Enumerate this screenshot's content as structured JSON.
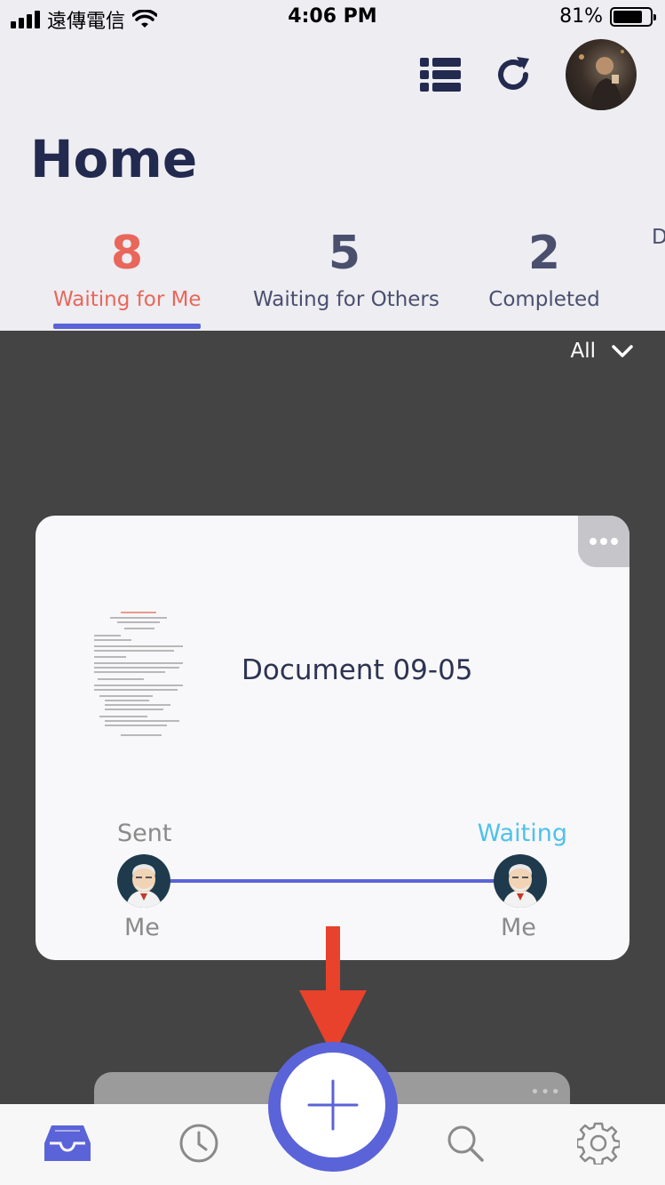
{
  "status_bar": {
    "carrier": "遠傳電信",
    "time": "4:06 PM",
    "battery_percent": "81%",
    "battery_level": 0.81
  },
  "header": {
    "title": "Home",
    "list_icon": "list-icon",
    "refresh_icon": "refresh-icon",
    "avatar": "user-avatar"
  },
  "tabs": [
    {
      "count": "8",
      "label": "Waiting for Me",
      "active": true
    },
    {
      "count": "5",
      "label": "Waiting for Others",
      "active": false
    },
    {
      "count": "2",
      "label": "Completed",
      "active": false
    },
    {
      "count": "",
      "label": "D",
      "active": false
    }
  ],
  "filter": {
    "label": "All"
  },
  "document_card": {
    "title": "Document 09-05",
    "sender_status": "Sent",
    "sender_name": "Me",
    "recipient_status": "Waiting",
    "recipient_name": "Me"
  },
  "bottom_nav": {
    "items": [
      "inbox-icon",
      "clock-icon",
      "search-icon",
      "settings-icon"
    ],
    "fab_icon": "plus-icon"
  },
  "colors": {
    "accent": "#5b63d8",
    "active_tab": "#e8675a",
    "waiting": "#4fc1ea",
    "arrow": "#e8412c",
    "title": "#232a4f"
  }
}
